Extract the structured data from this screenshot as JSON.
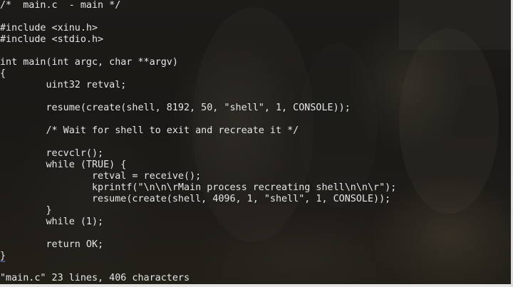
{
  "editor": {
    "lines": [
      "/*  main.c  - main */",
      "",
      "#include <xinu.h>",
      "#include <stdio.h>",
      "",
      "int main(int argc, char **argv)",
      "{",
      "        uint32 retval;",
      "",
      "        resume(create(shell, 8192, 50, \"shell\", 1, CONSOLE));",
      "",
      "        /* Wait for shell to exit and recreate it */",
      "",
      "        recvclr();",
      "        while (TRUE) {",
      "                retval = receive();",
      "                kprintf(\"\\n\\n\\rMain process recreating shell\\n\\n\\r\");",
      "                resume(create(shell, 4096, 1, \"shell\", 1, CONSOLE));",
      "        }",
      "        while (1);",
      "",
      "        return OK;",
      "}"
    ],
    "empty_line_marker": "~",
    "status_line": "\"main.c\" 23 lines, 406 characters"
  },
  "colors": {
    "text": "#e6e6e6",
    "tilde": "#6f7fd6",
    "background": "#1b1a17"
  }
}
